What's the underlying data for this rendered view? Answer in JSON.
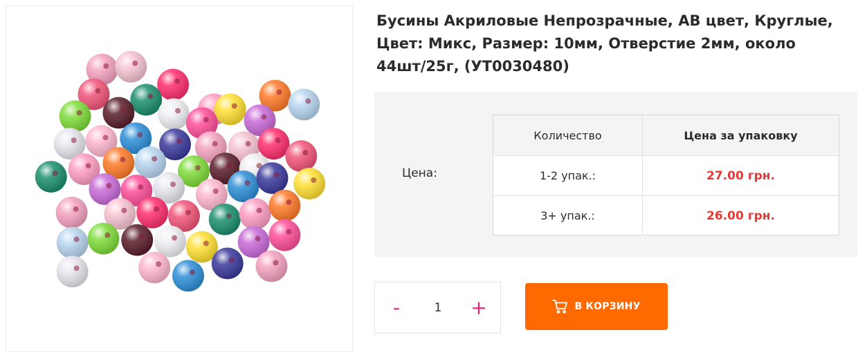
{
  "product": {
    "title": "Бусины Акриловые Непрозрачные, АВ цвет, Круглые, Цвет: Микс, Размер: 10мм, Отверстие 2мм, около 44шт/25г, (УТ0030480)"
  },
  "pricing": {
    "label": "Цена:",
    "headers": {
      "quantity": "Количество",
      "price": "Цена за упаковку"
    },
    "rows": [
      {
        "quantity": "1-2 упак.:",
        "price": "27.00 грн."
      },
      {
        "quantity": "3+ упак.:",
        "price": "26.00 грн."
      }
    ]
  },
  "quantity": {
    "minus": "-",
    "value": "1",
    "plus": "+"
  },
  "cart": {
    "label": "В КОРЗИНУ",
    "icon": "cart-icon"
  },
  "colors": {
    "accent": "#ff6a00",
    "price": "#e53935",
    "stepper": "#e0257a"
  },
  "image": {
    "alt": "colorful-acrylic-beads-photo"
  }
}
